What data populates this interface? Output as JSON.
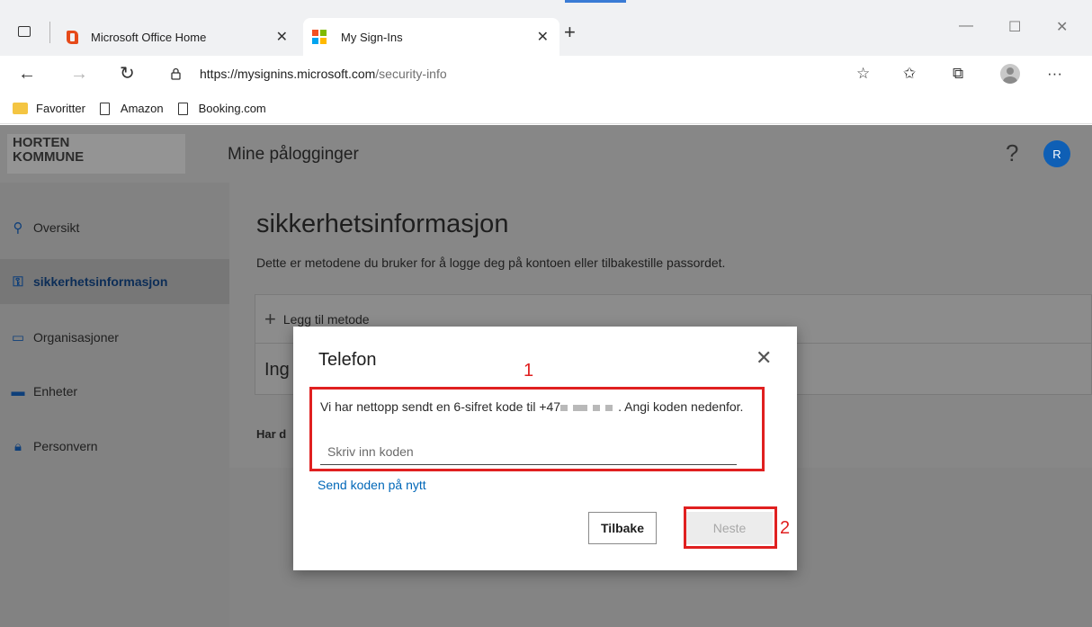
{
  "browser": {
    "tabs": [
      {
        "label": "Microsoft Office Home",
        "active": false
      },
      {
        "label": "My Sign-Ins",
        "active": true
      }
    ],
    "new_tab": "+",
    "window_controls": {
      "minimize": "—",
      "maximize": "☐",
      "close": "✕"
    },
    "url_host": "https://mysignins.microsoft.com",
    "url_path": "/security-info",
    "bookmarks": [
      "Favoritter",
      "Amazon",
      "Booking.com"
    ],
    "more_label": "···"
  },
  "header": {
    "org_logo_line1": "HORTEN",
    "org_logo_line2": "KOMMUNE",
    "app_title": "Mine pålogginger",
    "help": "?",
    "avatar_initial": "R"
  },
  "sidebar": {
    "items": [
      {
        "label": "Oversikt",
        "icon": "person-icon",
        "selected": false
      },
      {
        "label": "sikkerhetsinformasjon",
        "icon": "security-info-icon",
        "selected": true
      },
      {
        "label": "Organisasjoner",
        "icon": "briefcase-icon",
        "selected": false
      },
      {
        "label": "Enheter",
        "icon": "laptop-icon",
        "selected": false
      },
      {
        "label": "Personvern",
        "icon": "lock-icon",
        "selected": false
      }
    ]
  },
  "main": {
    "title": "sikkerhetsinformasjon",
    "description": "Dette er metodene du bruker for å logge deg på kontoen eller tilbakestille passordet.",
    "add_method": "Legg til metode",
    "no_items_prefix": "Ing",
    "lost_device_prefix": "Har d"
  },
  "dialog": {
    "title": "Telefon",
    "message_start": "Vi har nettopp sendt en 6-sifret kode til +47",
    "message_end": ". Angi koden nedenfor.",
    "code_placeholder": "Skriv inn koden",
    "resend": "Send koden på nytt",
    "back_button": "Tilbake",
    "next_button": "Neste"
  },
  "annotations": {
    "label_1": "1",
    "label_2": "2",
    "color": "#e02020"
  },
  "colors": {
    "accent": "#0067b8",
    "avatar": "#0f5fb5",
    "overlay": "#878787"
  }
}
